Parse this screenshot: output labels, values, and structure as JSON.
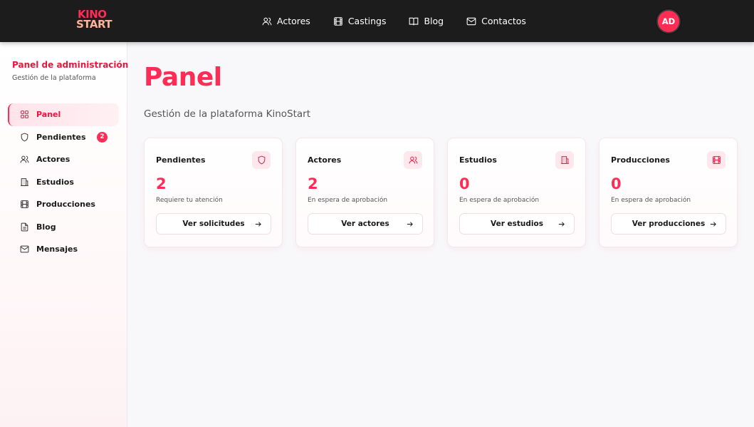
{
  "brand": {
    "logo_line1": "KINO",
    "logo_line2": "START",
    "accent": "#ff2d55"
  },
  "topnav": {
    "items": [
      {
        "label": "Actores",
        "icon": "users-icon"
      },
      {
        "label": "Castings",
        "icon": "film-icon"
      },
      {
        "label": "Blog",
        "icon": "book-icon"
      },
      {
        "label": "Contactos",
        "icon": "mail-icon"
      }
    ],
    "avatar": "AD"
  },
  "sidebar": {
    "title": "Panel de administración",
    "subtitle": "Gestión de la plataforma",
    "items": [
      {
        "label": "Panel",
        "icon": "grid-icon",
        "active": true
      },
      {
        "label": "Pendientes",
        "icon": "shield-icon",
        "badge": "2"
      },
      {
        "label": "Actores",
        "icon": "users-icon"
      },
      {
        "label": "Estudios",
        "icon": "building-icon"
      },
      {
        "label": "Producciones",
        "icon": "film-icon"
      },
      {
        "label": "Blog",
        "icon": "document-icon"
      },
      {
        "label": "Mensajes",
        "icon": "mail-icon"
      }
    ]
  },
  "main": {
    "title": "Panel",
    "subtitle": "Gestión de la plataforma KinoStart",
    "cards": [
      {
        "title": "Pendientes",
        "icon": "shield-icon",
        "value": "2",
        "caption": "Requiere tu atención",
        "button": "Ver solicitudes"
      },
      {
        "title": "Actores",
        "icon": "users-icon",
        "value": "2",
        "caption": "En espera de aprobación",
        "button": "Ver actores"
      },
      {
        "title": "Estudios",
        "icon": "building-icon",
        "value": "0",
        "caption": "En espera de aprobación",
        "button": "Ver estudios"
      },
      {
        "title": "Producciones",
        "icon": "film-icon",
        "value": "0",
        "caption": "En espera de aprobación",
        "button": "Ver producciones"
      }
    ]
  }
}
